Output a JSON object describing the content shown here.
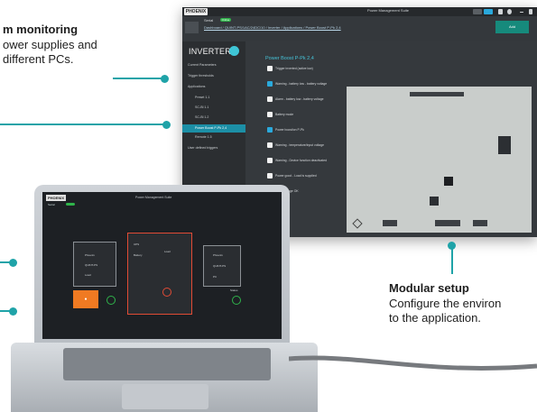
{
  "callouts": {
    "system_monitoring": {
      "title": "m monitoring",
      "line1": "ower supplies and",
      "line2": "different PCs."
    },
    "modular_setup": {
      "title": "Modular setup",
      "line1": "Configure the environ",
      "line2": "to the application."
    }
  },
  "colors": {
    "accent": "#1fa3a8",
    "window_bg": "#2f3236",
    "sidebar_active": "#1c8fa6",
    "online": "#2fb34a",
    "alert_red": "#e14b35",
    "orange": "#f07a22",
    "heading_cyan": "#46c3d8"
  },
  "monitor_window": {
    "brand": "PHOENIX",
    "app_title": "Power Management Suite",
    "serial_label": "Serial",
    "online_badge": "Online",
    "breadcrumb": "Dashboard / QUINT-PS/1AC/24DC/10 / Inverter / Applications / Power Boost P-Pk 2,4",
    "add_button": "Add",
    "sidebar": {
      "title": "INVERTER",
      "items": [
        {
          "label": "Current Parameters",
          "sub": false
        },
        {
          "label": "Trigger thresholds",
          "sub": false
        },
        {
          "label": "Applications",
          "sub": false
        },
        {
          "label": "Preset 1.1",
          "sub": true
        },
        {
          "label": "SC-Bl 1.1",
          "sub": true
        },
        {
          "label": "SC-Bl 1.2",
          "sub": true
        },
        {
          "label": "Power Boost P-Pk 2,4",
          "sub": true,
          "active": true
        },
        {
          "label": "Remote 1.5",
          "sub": true
        },
        {
          "label": "User defined triggers",
          "sub": false
        }
      ]
    },
    "content_title": "Power Boost P-Pk 2,4",
    "checkboxes": [
      {
        "label": "Trigger inverted (active low)",
        "checked": false
      },
      {
        "label": "Warning - battery low - battery voltage",
        "checked": true
      },
      {
        "label": "Alarm - battery low - battery voltage",
        "checked": false
      },
      {
        "label": "Battery mode",
        "checked": false
      },
      {
        "label": "Power boost/on P-Pk",
        "checked": true
      },
      {
        "label": "Warning - temperature/input voltage",
        "checked": false
      },
      {
        "label": "Warning - Device function deactivated",
        "checked": false
      },
      {
        "label": "Power good - Load is supplied",
        "checked": false
      },
      {
        "label": "Input Voltage OK",
        "checked": false
      }
    ]
  },
  "laptop_screen": {
    "brand": "PHOENIX",
    "title": "Power Management Suite",
    "serial": "Serial",
    "orange_button": "●",
    "node_labels": [
      "Phoenix",
      "QUINT-PS",
      "UPS",
      "Battery",
      "Load",
      "PC",
      "Status"
    ]
  }
}
